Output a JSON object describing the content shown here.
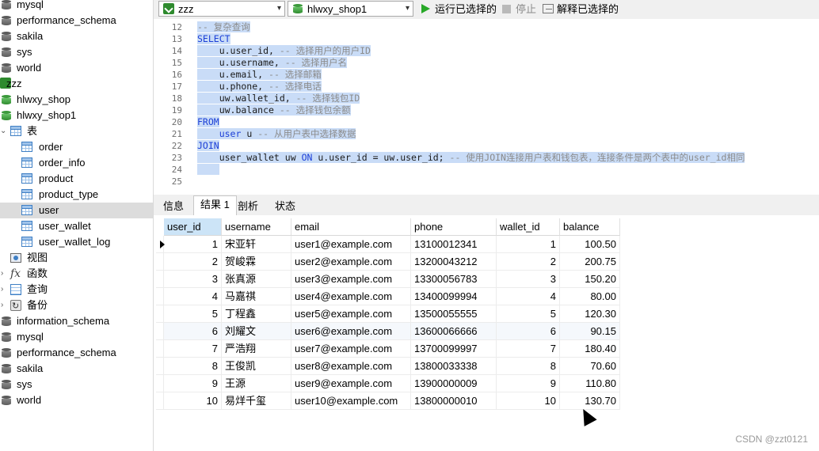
{
  "sidebar": {
    "top_dbs": [
      "mysql",
      "performance_schema",
      "sakila",
      "sys",
      "world"
    ],
    "connection": "zzz",
    "conn_dbs": [
      "hlwxy_shop",
      "hlwxy_shop1"
    ],
    "tables_label": "表",
    "tables": [
      "order",
      "order_info",
      "product",
      "product_type",
      "user",
      "user_wallet",
      "user_wallet_log"
    ],
    "selected_table": "user",
    "views_label": "视图",
    "functions_label": "函数",
    "queries_label": "查询",
    "backups_label": "备份",
    "bottom_dbs": [
      "information_schema",
      "mysql",
      "performance_schema",
      "sakila",
      "sys",
      "world"
    ]
  },
  "toolbar": {
    "connection_value": "zzz",
    "database_value": "hlwxy_shop1",
    "run_selected_label": "运行已选择的",
    "stop_label": "停止",
    "explain_selected_label": "解释已选择的"
  },
  "editor": {
    "line_numbers": [
      "12",
      "13",
      "14",
      "15",
      "16",
      "17",
      "18",
      "19",
      "20",
      "21",
      "22",
      "23",
      "24",
      "25"
    ],
    "lines": [
      {
        "code": "",
        "comment": "-- 复杂查询"
      },
      {
        "kw": "SELECT"
      },
      {
        "code": "    u.user_id, ",
        "comment": "-- 选择用户的用户ID"
      },
      {
        "code": "    u.username, ",
        "comment": "-- 选择用户名"
      },
      {
        "code": "    u.email, ",
        "comment": "-- 选择邮箱"
      },
      {
        "code": "    u.phone, ",
        "comment": "-- 选择电话"
      },
      {
        "code": "    uw.wallet_id, ",
        "comment": "-- 选择钱包ID"
      },
      {
        "code": "    uw.balance ",
        "comment": "-- 选择钱包余额"
      },
      {
        "kw": "FROM"
      },
      {
        "code": "    ",
        "kw2": "user",
        "code2": " u ",
        "comment": "-- 从用户表中选择数据"
      },
      {
        "kw": "JOIN"
      },
      {
        "code": "    user_wallet uw ",
        "kw2": "ON",
        "code2": " u.user_id = uw.user_id; ",
        "comment": "-- 使用JOIN连接用户表和钱包表，连接条件是两个表中的user_id相同"
      },
      {
        "code": "    "
      },
      {
        "code": ""
      }
    ]
  },
  "result_tabs": [
    "信息",
    "结果 1",
    "剖析",
    "状态"
  ],
  "active_tab": "结果 1",
  "grid": {
    "columns": [
      "user_id",
      "username",
      "email",
      "phone",
      "wallet_id",
      "balance"
    ],
    "rows": [
      [
        "1",
        "宋亚轩",
        "user1@example.com",
        "13100012341",
        "1",
        "100.50"
      ],
      [
        "2",
        "贺峻霖",
        "user2@example.com",
        "13200043212",
        "2",
        "200.75"
      ],
      [
        "3",
        "张真源",
        "user3@example.com",
        "13300056783",
        "3",
        "150.20"
      ],
      [
        "4",
        "马嘉祺",
        "user4@example.com",
        "13400099994",
        "4",
        "80.00"
      ],
      [
        "5",
        "丁程鑫",
        "user5@example.com",
        "13500055555",
        "5",
        "120.30"
      ],
      [
        "6",
        "刘耀文",
        "user6@example.com",
        "13600066666",
        "6",
        "90.15"
      ],
      [
        "7",
        "严浩翔",
        "user7@example.com",
        "13700099997",
        "7",
        "180.40"
      ],
      [
        "8",
        "王俊凯",
        "user8@example.com",
        "13800033338",
        "8",
        "70.60"
      ],
      [
        "9",
        "王源",
        "user9@example.com",
        "13900000009",
        "9",
        "110.80"
      ],
      [
        "10",
        "易烊千玺",
        "user10@example.com",
        "13800000010",
        "10",
        "130.70"
      ]
    ]
  },
  "watermark": "CSDN @zzt0121"
}
